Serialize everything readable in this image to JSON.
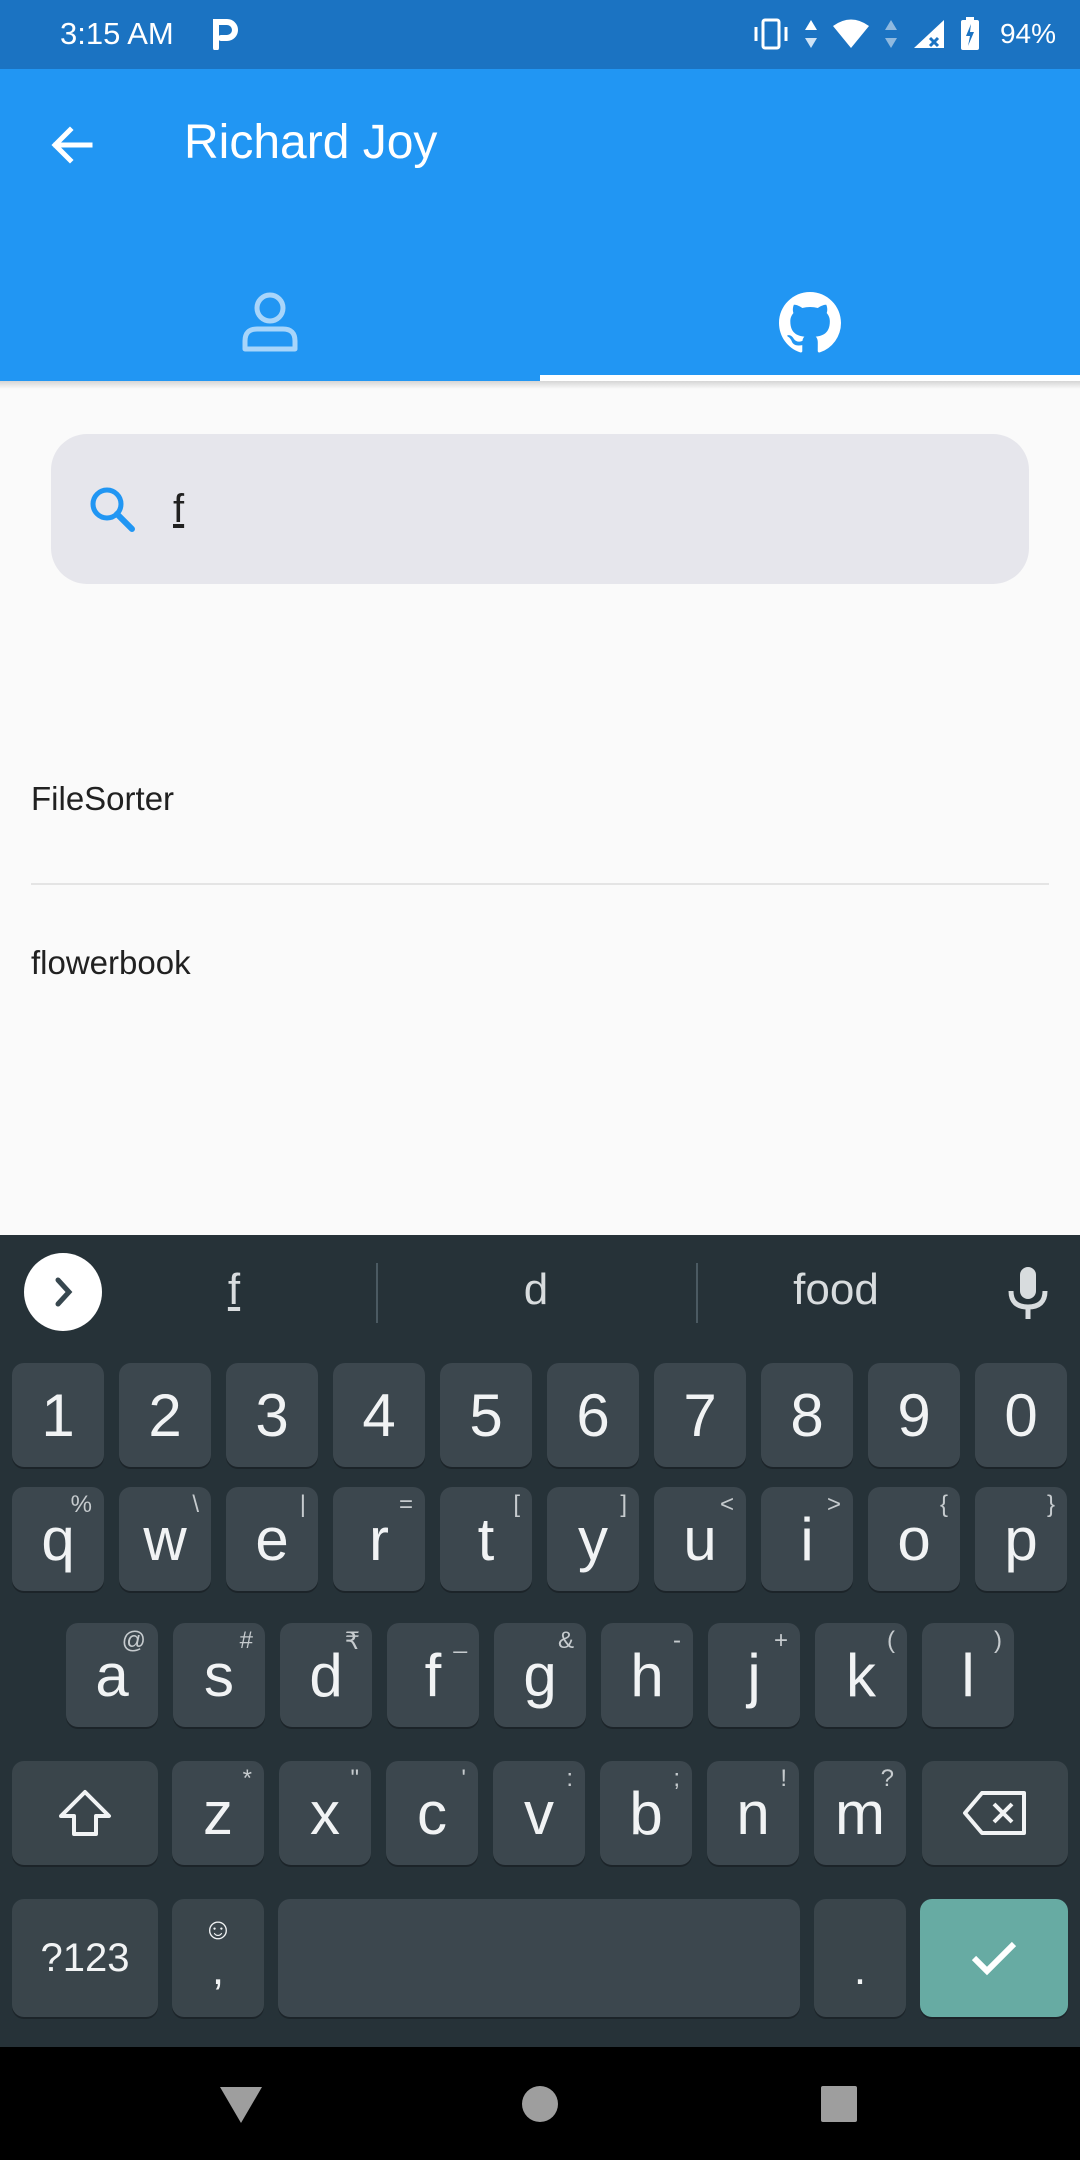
{
  "status_bar": {
    "time": "3:15 AM",
    "notification_icon": "parking-p-icon",
    "battery_percent": "94%"
  },
  "app_bar": {
    "title": "Richard Joy",
    "back_icon": "arrow-left-icon",
    "tabs": [
      {
        "icon": "person-icon",
        "selected": false
      },
      {
        "icon": "github-icon",
        "selected": true
      }
    ],
    "colors": {
      "primary": "#2196f3",
      "status": "#1b73c2"
    }
  },
  "search": {
    "query": "f"
  },
  "results": [
    {
      "label": "FileSorter"
    },
    {
      "label": "flowerbook"
    }
  ],
  "keyboard": {
    "suggestions": [
      "f",
      "d",
      "food"
    ],
    "row_numbers": [
      "1",
      "2",
      "3",
      "4",
      "5",
      "6",
      "7",
      "8",
      "9",
      "0"
    ],
    "row1": [
      {
        "k": "q",
        "s": "%"
      },
      {
        "k": "w",
        "s": "\\"
      },
      {
        "k": "e",
        "s": "|"
      },
      {
        "k": "r",
        "s": "="
      },
      {
        "k": "t",
        "s": "["
      },
      {
        "k": "y",
        "s": "]"
      },
      {
        "k": "u",
        "s": "<"
      },
      {
        "k": "i",
        "s": ">"
      },
      {
        "k": "o",
        "s": "{"
      },
      {
        "k": "p",
        "s": "}"
      }
    ],
    "row2": [
      {
        "k": "a",
        "s": "@"
      },
      {
        "k": "s",
        "s": "#"
      },
      {
        "k": "d",
        "s": "₹"
      },
      {
        "k": "f",
        "s": "_"
      },
      {
        "k": "g",
        "s": "&"
      },
      {
        "k": "h",
        "s": "-"
      },
      {
        "k": "j",
        "s": "+"
      },
      {
        "k": "k",
        "s": "("
      },
      {
        "k": "l",
        "s": ")"
      }
    ],
    "row3": [
      {
        "k": "z",
        "s": "*"
      },
      {
        "k": "x",
        "s": "\""
      },
      {
        "k": "c",
        "s": "'"
      },
      {
        "k": "v",
        "s": ":"
      },
      {
        "k": "b",
        "s": ";"
      },
      {
        "k": "n",
        "s": "!"
      },
      {
        "k": "m",
        "s": "?"
      }
    ],
    "symbols_label": "?123",
    "comma_label": ",",
    "period_label": ".",
    "emoji_label": "☺"
  }
}
